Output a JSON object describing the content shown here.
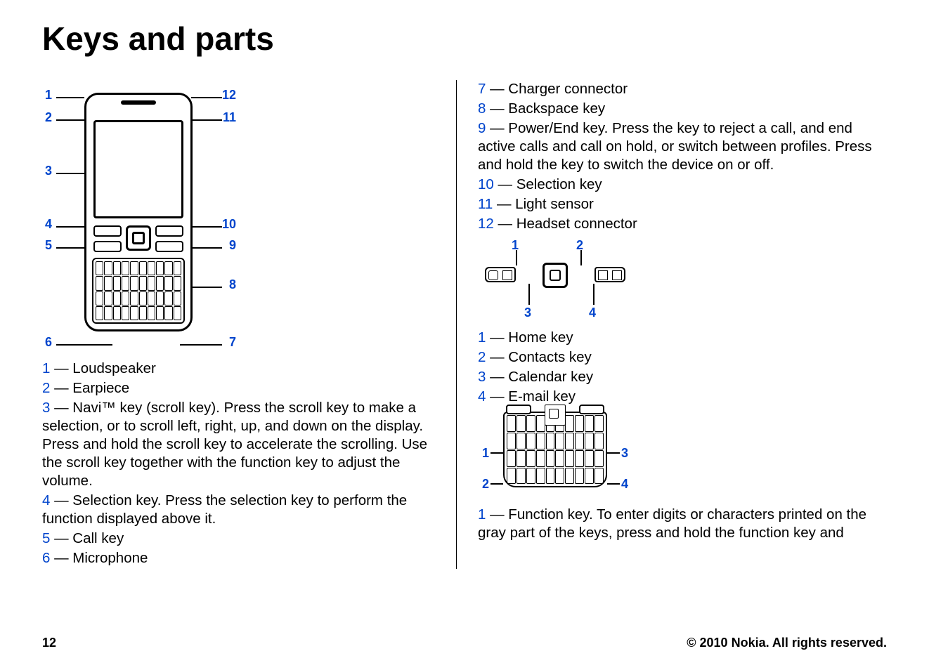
{
  "title": "Keys and parts",
  "phone_legend": [
    {
      "n": "1",
      "text": " — Loudspeaker"
    },
    {
      "n": "2",
      "text": " — Earpiece"
    },
    {
      "n": "3",
      "text": " — Navi™ key (scroll key). Press the scroll key to make a selection, or to scroll left, right, up, and down on the display. Press and hold the scroll key to accelerate the scrolling. Use the scroll key together with the function key to adjust the volume."
    },
    {
      "n": "4",
      "text": " — Selection key. Press the selection key to perform the function displayed above it."
    },
    {
      "n": "5",
      "text": " — Call key"
    },
    {
      "n": "6",
      "text": " — Microphone"
    }
  ],
  "right_legend": [
    {
      "n": "7",
      "text": " — Charger connector"
    },
    {
      "n": "8",
      "text": " — Backspace key"
    },
    {
      "n": "9",
      "text": " — Power/End key. Press the key to reject a call, and end active calls and call on hold, or switch between profiles. Press and hold the key to switch the device on or off."
    },
    {
      "n": "10",
      "text": " — Selection key"
    },
    {
      "n": "11",
      "text": " — Light sensor"
    },
    {
      "n": "12",
      "text": " — Headset connector"
    }
  ],
  "keypad_legend": [
    {
      "n": "1",
      "text": " — Home key"
    },
    {
      "n": "2",
      "text": " — Contacts key"
    },
    {
      "n": "3",
      "text": " — Calendar key"
    },
    {
      "n": "4",
      "text": " — E-mail key"
    }
  ],
  "keyboard_legend": [
    {
      "n": "1",
      "text": " — Function key. To enter digits or characters printed on the gray part of the keys, press and hold the function key and"
    }
  ],
  "diagram_labels": {
    "phone": {
      "l1": "1",
      "l2": "2",
      "l3": "3",
      "l4": "4",
      "l5": "5",
      "l6": "6",
      "l7": "7",
      "l8": "8",
      "l9": "9",
      "l10": "10",
      "l11": "11",
      "l12": "12"
    },
    "keypad": {
      "k1": "1",
      "k2": "2",
      "k3": "3",
      "k4": "4"
    },
    "keyboard": {
      "b1": "1",
      "b2": "2",
      "b3": "3",
      "b4": "4"
    }
  },
  "footer": {
    "page": "12",
    "copyright": "© 2010 Nokia. All rights reserved."
  }
}
